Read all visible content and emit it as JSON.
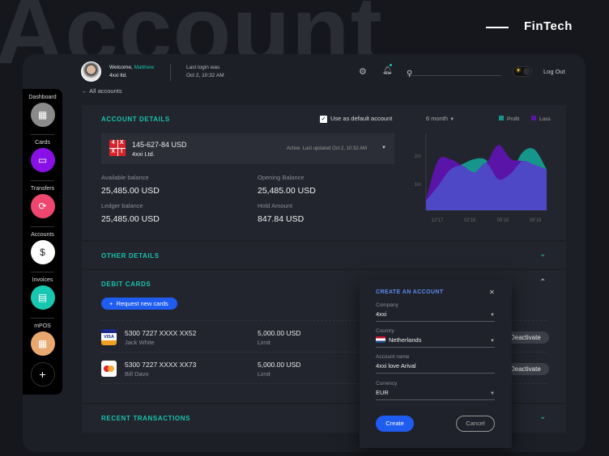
{
  "page": {
    "big_title": "Account",
    "brand": "FinTech"
  },
  "header": {
    "welcome": "Welcome,",
    "user_name": "Matthew",
    "company": "4xxi ltd.",
    "last_login_label": "Last login was",
    "last_login": "Oct 2, 10:32 AM",
    "search_placeholder": "",
    "logout": "Log Out",
    "back_link": "All accounts"
  },
  "sidebar": {
    "items": [
      {
        "label": "Dashboard",
        "color": "#8a8a8a"
      },
      {
        "label": "Cards",
        "color": "#8a10e8"
      },
      {
        "label": "Transfers",
        "color": "#ef4670"
      },
      {
        "label": "Accounts",
        "color": "#ffffff"
      },
      {
        "label": "Invoices",
        "color": "#17c7b0"
      },
      {
        "label": "mPOS",
        "color": "#e8a870"
      }
    ],
    "add": "+"
  },
  "account_details": {
    "title": "ACCOUNT DETAILS",
    "default_checkbox": "Use as default account",
    "period": "6 month",
    "logo": [
      "4",
      "X",
      "X",
      "I"
    ],
    "account_number": "145-627-84 USD",
    "account_company": "4xxi Ltd.",
    "status": "Active. Last updated Oct 2, 10:32 AM",
    "balances": [
      {
        "label": "Available balance",
        "value": "25,485.00 USD"
      },
      {
        "label": "Opening Balance",
        "value": "25,485.00 USD"
      },
      {
        "label": "Ledger balance",
        "value": "25,485.00 USD"
      },
      {
        "label": "Hold Amount",
        "value": "847.84 USD"
      }
    ]
  },
  "chart_data": {
    "type": "area",
    "x_labels": [
      "12'17",
      "02'18",
      "05'18",
      "08'18"
    ],
    "y_ticks": [
      "1m",
      "2m"
    ],
    "ylim": [
      0,
      2.6
    ],
    "series": [
      {
        "name": "Profit",
        "color": "#16968a",
        "values": [
          0.42,
          0.94,
          1.51,
          1.71,
          1.89,
          1.85,
          1.18,
          1.37,
          2.13,
          2.23,
          1.53
        ]
      },
      {
        "name": "Loss",
        "color": "#5a14a8",
        "values": [
          0.47,
          1.85,
          1.89,
          1.66,
          1.42,
          1.75,
          2.39,
          1.91,
          1.82,
          1.69,
          1.53
        ]
      }
    ],
    "overlap_color": "#4e48c6",
    "legend": "top-right"
  },
  "other_details": {
    "title": "OTHER DETAILS"
  },
  "debit_cards": {
    "title": "DEBIT CARDS",
    "request_button": "Request new cards",
    "cards": [
      {
        "brand": "VISA",
        "number": "5300 7227 XXXX XX52",
        "holder": "Jack White",
        "limit": "5,000.00 USD",
        "limit_label": "Limit",
        "action": "Deactivate"
      },
      {
        "brand": "mastercard",
        "number": "5300 7227 XXXX XX73",
        "holder": "Bill Davo",
        "limit": "5,000.00 USD",
        "limit_label": "Limit",
        "action": "Deactivate"
      }
    ]
  },
  "recent_transactions": {
    "title": "RECENT TRANSACTIONS"
  },
  "modal": {
    "title": "CREATE AN ACCOUNT",
    "close": "✕",
    "company_label": "Company",
    "company": "4xxi",
    "country_label": "Country",
    "country": "Netherlands",
    "account_name_label": "Account name",
    "account_name": "4xxi love Arival",
    "currency_label": "Currency",
    "currency": "EUR",
    "create": "Create",
    "cancel": "Cancel"
  }
}
